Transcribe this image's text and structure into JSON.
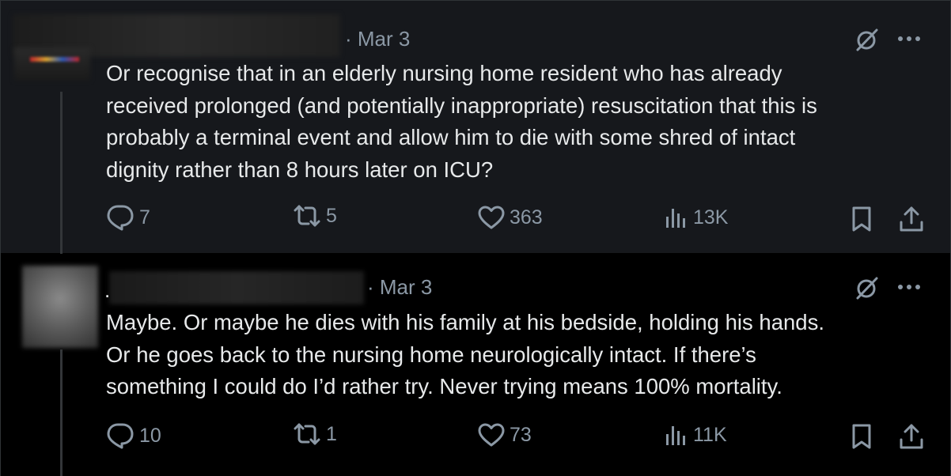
{
  "tweets": [
    {
      "date": "· Mar 3",
      "text": "Or recognise that in an elderly nursing home resident who has already\nreceived prolonged (and potentially inappropriate) resuscitation that this is\nprobably a terminal event and allow him to die with some shred of intact\ndignity rather than 8 hours later on ICU?",
      "replies": "7",
      "reposts": "5",
      "likes": "363",
      "views": "13K"
    },
    {
      "name_prefix": ".",
      "date": "· Mar 3",
      "text": "Maybe. Or maybe he dies with his family at his bedside, holding his hands.\nOr he goes back to the nursing home neurologically intact. If there’s\nsomething I could do I’d rather try. Never trying means 100% mortality.",
      "replies": "10",
      "reposts": "1",
      "likes": "73",
      "views": "11K"
    }
  ],
  "icons": [
    "grok-icon",
    "more-icon",
    "reply-icon",
    "repost-icon",
    "like-icon",
    "views-icon",
    "bookmark-icon",
    "share-icon"
  ],
  "colors": {
    "background": "#000000",
    "highlight_background": "#16181c",
    "text": "#e7e9ea",
    "muted": "#8b98a5",
    "divider": "#333639"
  }
}
